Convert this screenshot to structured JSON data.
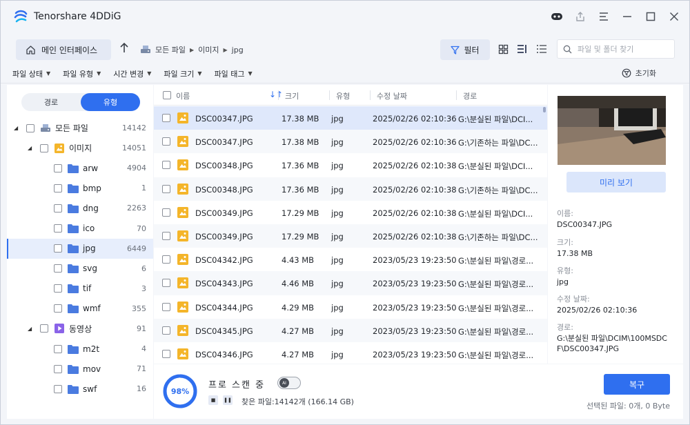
{
  "app": {
    "title": "Tenorshare 4DDiG"
  },
  "nav": {
    "home_label": "메인 인터페이스",
    "breadcrumb": [
      "모든 파일",
      "이미지",
      "jpg"
    ],
    "filter_label": "필터",
    "search_placeholder": "파일 및 폴더 찾기"
  },
  "filters": {
    "items": [
      "파일 상태",
      "파일 유형",
      "시간 변경",
      "파일 크기",
      "파일 태그"
    ],
    "reset_label": "초기화"
  },
  "sidebar": {
    "toggle": [
      "경로",
      "유형"
    ],
    "tree": [
      {
        "name": "모든 파일",
        "count": "14142"
      },
      {
        "name": "이미지",
        "count": "14051"
      },
      {
        "name": "arw",
        "count": "4904"
      },
      {
        "name": "bmp",
        "count": "1"
      },
      {
        "name": "dng",
        "count": "2263"
      },
      {
        "name": "ico",
        "count": "70"
      },
      {
        "name": "jpg",
        "count": "6449"
      },
      {
        "name": "svg",
        "count": "6"
      },
      {
        "name": "tif",
        "count": "3"
      },
      {
        "name": "wmf",
        "count": "355"
      },
      {
        "name": "동영상",
        "count": "91"
      },
      {
        "name": "m2t",
        "count": "4"
      },
      {
        "name": "mov",
        "count": "71"
      },
      {
        "name": "swf",
        "count": "16"
      }
    ]
  },
  "table": {
    "headers": [
      "이름",
      "크기",
      "유형",
      "수정 날짜",
      "경로"
    ],
    "rows": [
      {
        "name": "DSC00347.JPG",
        "size": "17.38 MB",
        "type": "jpg",
        "date": "2025/02/26 02:10:36",
        "path": "G:\\분실된 파일\\DCI..."
      },
      {
        "name": "DSC00347.JPG",
        "size": "17.38 MB",
        "type": "jpg",
        "date": "2025/02/26 02:10:36",
        "path": "G:\\기존하는 파일\\DC..."
      },
      {
        "name": "DSC00348.JPG",
        "size": "17.36 MB",
        "type": "jpg",
        "date": "2025/02/26 02:10:38",
        "path": "G:\\분실된 파일\\DCI..."
      },
      {
        "name": "DSC00348.JPG",
        "size": "17.36 MB",
        "type": "jpg",
        "date": "2025/02/26 02:10:38",
        "path": "G:\\기존하는 파일\\DC..."
      },
      {
        "name": "DSC00349.JPG",
        "size": "17.29 MB",
        "type": "jpg",
        "date": "2025/02/26 02:10:38",
        "path": "G:\\분실된 파일\\DCI..."
      },
      {
        "name": "DSC00349.JPG",
        "size": "17.29 MB",
        "type": "jpg",
        "date": "2025/02/26 02:10:38",
        "path": "G:\\기존하는 파일\\DC..."
      },
      {
        "name": "DSC04342.JPG",
        "size": "4.43 MB",
        "type": "jpg",
        "date": "2023/05/23 19:23:50",
        "path": "G:\\분실된 파일\\경로..."
      },
      {
        "name": "DSC04343.JPG",
        "size": "4.46 MB",
        "type": "jpg",
        "date": "2023/05/23 19:23:50",
        "path": "G:\\분실된 파일\\경로..."
      },
      {
        "name": "DSC04344.JPG",
        "size": "4.29 MB",
        "type": "jpg",
        "date": "2023/05/23 19:23:50",
        "path": "G:\\분실된 파일\\경로..."
      },
      {
        "name": "DSC04345.JPG",
        "size": "4.27 MB",
        "type": "jpg",
        "date": "2023/05/23 19:23:50",
        "path": "G:\\분실된 파일\\경로..."
      },
      {
        "name": "DSC04346.JPG",
        "size": "4.27 MB",
        "type": "jpg",
        "date": "2023/05/23 19:23:50",
        "path": "G:\\분실된 파일\\경로..."
      }
    ]
  },
  "preview": {
    "button_label": "미리 보기",
    "name_label": "이름:",
    "name_value": "DSC00347.JPG",
    "size_label": "크기:",
    "size_value": "17.38 MB",
    "type_label": "유형:",
    "type_value": "jpg",
    "date_label": "수정 날짜:",
    "date_value": "2025/02/26 02:10:36",
    "path_label": "경로:",
    "path_value": "G:\\분실된 파일\\DCIM\\100MSDCF\\DSC00347.JPG"
  },
  "status": {
    "progress_label": "98%",
    "progress_value": 0.98,
    "scan_title": "프로 스캔 중",
    "ai_label": "AI",
    "found_text": "찾은 파일:14142개 (166.14 GB)",
    "recover_label": "복구",
    "selected_text": "선택된 파일: 0개, 0 Byte"
  },
  "colors": {
    "accent": "#2f6fef",
    "folder": "#4a7be0",
    "image_icon": "#f4b52a",
    "video_icon": "#8a63e8"
  }
}
